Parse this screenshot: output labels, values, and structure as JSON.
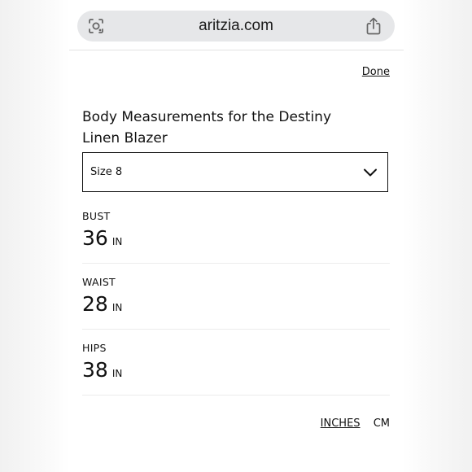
{
  "browser": {
    "url": "aritzia.com",
    "icons": {
      "lens": "visual-search-icon",
      "share": "share-icon"
    }
  },
  "sheet": {
    "done_label": "Done",
    "title": "Body Measurements for the Destiny Linen Blazer",
    "size_select": {
      "selected": "Size 8",
      "icon": "chevron-down-icon"
    },
    "measurements": [
      {
        "label": "BUST",
        "value": "36",
        "unit": "IN"
      },
      {
        "label": "WAIST",
        "value": "28",
        "unit": "IN"
      },
      {
        "label": "HIPS",
        "value": "38",
        "unit": "IN"
      }
    ],
    "units": {
      "inches": "INCHES",
      "cm": "CM",
      "active": "INCHES"
    }
  },
  "colors": {
    "url_bar": "#e6e7e9",
    "text": "#111111",
    "divider": "#ececec"
  }
}
